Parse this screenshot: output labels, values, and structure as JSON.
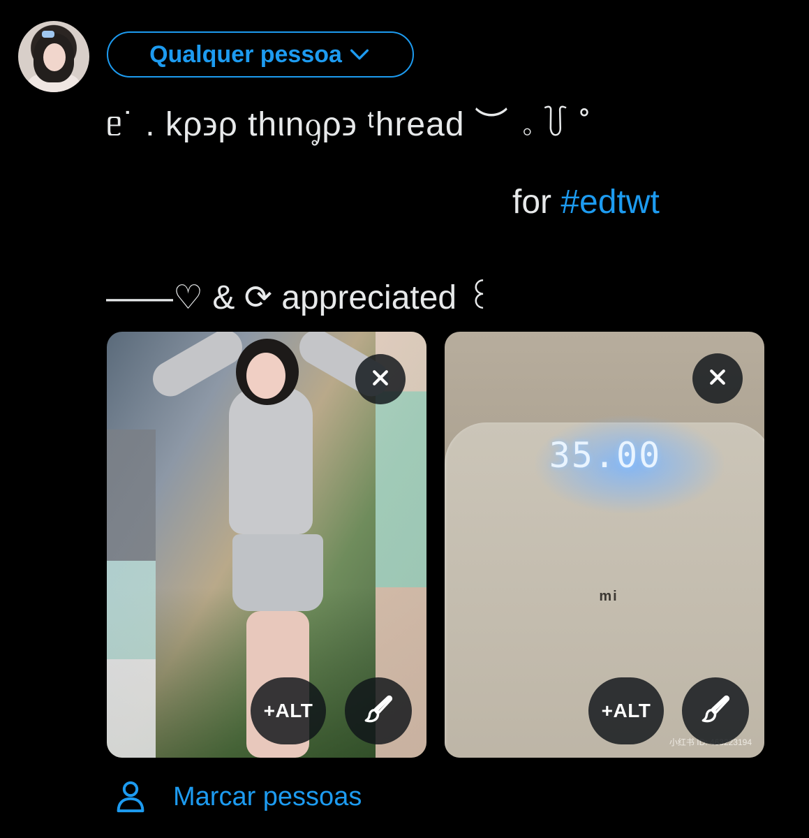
{
  "audience": {
    "label": "Qualquer pessoa"
  },
  "post": {
    "line1": "ᥱ˙ . kρ϶ρ thιnᧁρ϶ ᵗhread ︶ ｡ ꒦ ˚",
    "line2_prefix": "for ",
    "line2_hashtag": "#edtwt",
    "line3": "——♡  &  ⟳  appreciated  ꒰"
  },
  "media": [
    {
      "alt_label": "+ALT"
    },
    {
      "alt_label": "+ALT",
      "scale_reading": "35.00",
      "scale_brand": "mi",
      "watermark": "小红书 ID: 463223194"
    }
  ],
  "tag_people": {
    "label": "Marcar pessoas"
  },
  "colors": {
    "accent": "#1d9bf0",
    "background": "#000000",
    "text": "#e7e9ea"
  },
  "icons": [
    "chevron-down-icon",
    "close-icon",
    "brush-icon",
    "person-icon"
  ]
}
